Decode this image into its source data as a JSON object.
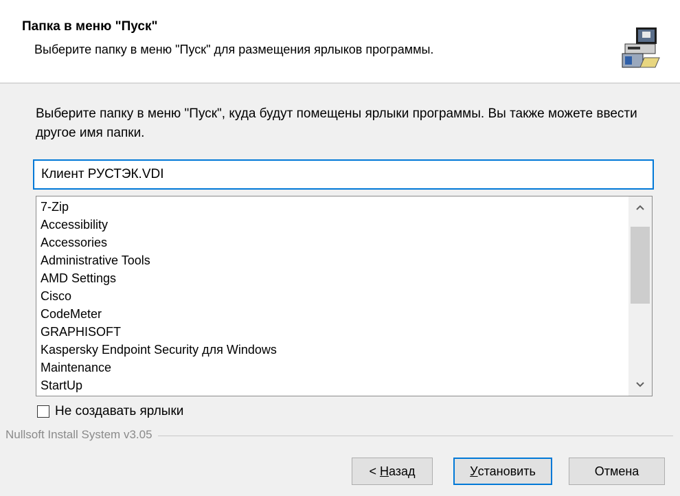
{
  "header": {
    "title": "Папка в меню \"Пуск\"",
    "subtitle": "Выберите папку в меню \"Пуск\" для размещения ярлыков программы.",
    "icon": "installer-computer-icon"
  },
  "instruction": "Выберите папку в меню \"Пуск\", куда будут помещены ярлыки программы. Вы также можете ввести другое имя папки.",
  "folder_input": {
    "value": "Клиент РУСТЭК.VDI"
  },
  "folder_list": {
    "items": [
      "7-Zip",
      "Accessibility",
      "Accessories",
      "Administrative Tools",
      "AMD Settings",
      "Cisco",
      "CodeMeter",
      "GRAPHISOFT",
      "Kaspersky Endpoint Security для Windows",
      "Maintenance",
      "StartUp"
    ]
  },
  "checkbox": {
    "label": "Не создавать ярлыки",
    "checked": false
  },
  "footer": {
    "branding": "Nullsoft Install System v3.05"
  },
  "buttons": {
    "back_prefix": "< ",
    "back_mnemonic": "Н",
    "back_rest": "азад",
    "install_mnemonic": "У",
    "install_rest": "становить",
    "cancel": "Отмена"
  },
  "colors": {
    "accent": "#0078d7",
    "background": "#f0f0f0"
  }
}
